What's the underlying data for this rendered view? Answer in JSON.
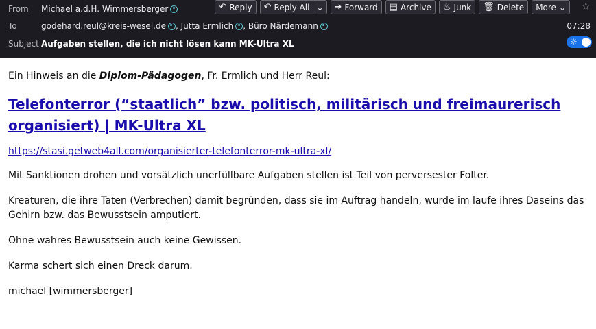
{
  "header": {
    "from_label": "From",
    "from_value": "Michael a.d.H. Wimmersberger",
    "to_label": "To",
    "recipients": [
      "godehard.reul@kreis-wesel.de",
      "Jutta Ermlich",
      "Büro Närdemann"
    ],
    "subject_label": "Subject",
    "subject": "Aufgaben stellen, die ich nicht lösen kann MK-Ultra XL",
    "time": "07:28"
  },
  "actions": {
    "reply": "Reply",
    "reply_all": "Reply All",
    "forward": "Forward",
    "archive": "Archive",
    "junk": "Junk",
    "delete": "Delete",
    "more": "More"
  },
  "message": {
    "intro_prefix": "Ein Hinweis an die ",
    "intro_emphasis": "Diplom-Pädagogen",
    "intro_suffix": ", Fr. Ermlich und Herr Reul:",
    "headline_link": "Telefonterror (“staatlich” bzw. politisch, militärisch und freimaurerisch organisiert) | MK-Ultra XL",
    "url": "https://stasi.getweb4all.com/organisierter-telefonterror-mk-ultra-xl/",
    "paragraphs": [
      "Mit Sanktionen drohen und vorsätzlich unerfüllbare Aufgaben stellen ist Teil von perversester Folter.",
      "Kreaturen, die ihre Taten (Verbrechen) damit begründen, dass sie im Auftrag handeln, wurde im laufe ihres Daseins das Gehirn bzw. das Bewusstsein amputiert.",
      "Ohne wahres Bewusstsein auch keine Gewissen.",
      "Karma schert sich einen Dreck darum.",
      "michael [wimmersberger]"
    ]
  },
  "colors": {
    "header_bg": "#1c1b22",
    "link": "#1a0dab",
    "toggle": "#1a73e8",
    "contact_icon": "#5ec0c9"
  }
}
